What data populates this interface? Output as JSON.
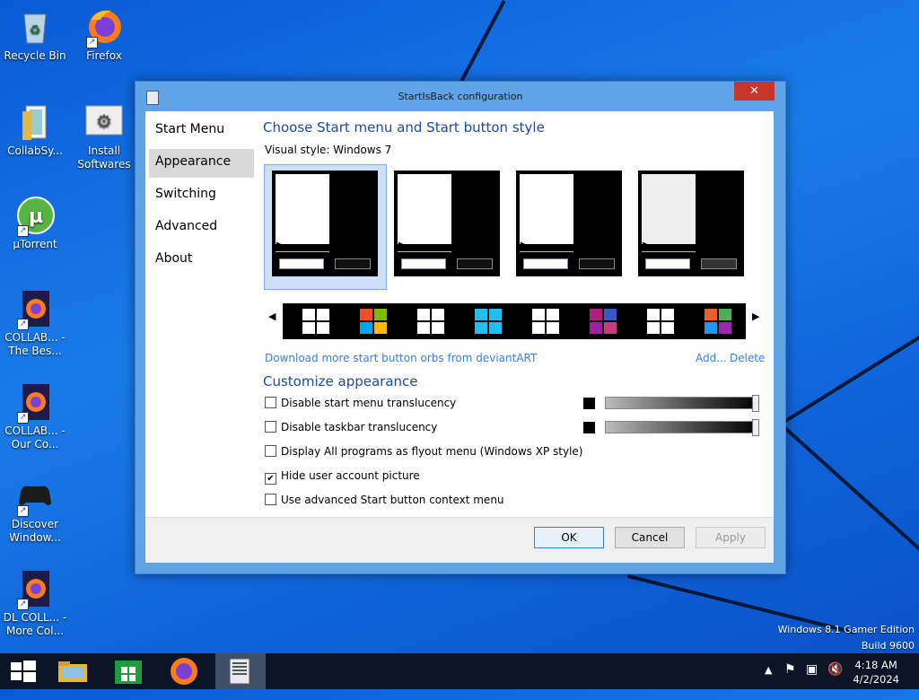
{
  "desktop": {
    "icons": [
      {
        "label": "Recycle Bin"
      },
      {
        "label": "Firefox"
      },
      {
        "label": "CollabSy..."
      },
      {
        "label": "Install Softwares"
      },
      {
        "label": "µTorrent"
      },
      {
        "label": "COLLAB... - The Bes..."
      },
      {
        "label": "COLLAB... - Our Co..."
      },
      {
        "label": "Discover Window..."
      },
      {
        "label": "DL COLL... - More Col..."
      }
    ],
    "watermark_line1": "Windows 8.1 Gamer Edition",
    "watermark_line2": "Build 9600"
  },
  "dialog": {
    "title": "StartIsBack configuration",
    "close_label": "✕",
    "nav": [
      {
        "label": "Start Menu"
      },
      {
        "label": "Appearance"
      },
      {
        "label": "Switching"
      },
      {
        "label": "Advanced"
      },
      {
        "label": "About"
      }
    ],
    "section1_title": "Choose Start menu and Start button style",
    "visual_style_label": "Visual style:",
    "visual_style_value": "Windows 7",
    "download_link": "Download more start button orbs from deviantART",
    "add_link": "Add...",
    "delete_link": "Delete",
    "section2_title": "Customize appearance",
    "options": [
      {
        "label": "Disable start menu translucency",
        "checked": false
      },
      {
        "label": "Disable taskbar translucency",
        "checked": false
      },
      {
        "label": "Display All programs as flyout menu (Windows XP style)",
        "checked": false
      },
      {
        "label": "Hide user account picture",
        "checked": true
      },
      {
        "label": "Use advanced Start button context menu",
        "checked": false
      }
    ],
    "ok_label": "OK",
    "cancel_label": "Cancel",
    "apply_label": "Apply"
  },
  "taskbar": {
    "clock_time": "4:18 AM",
    "clock_date": "4/2/2024"
  },
  "colors": {
    "accent": "#1e4a9b",
    "link": "#3d7fd6",
    "close": "#c7362a"
  }
}
